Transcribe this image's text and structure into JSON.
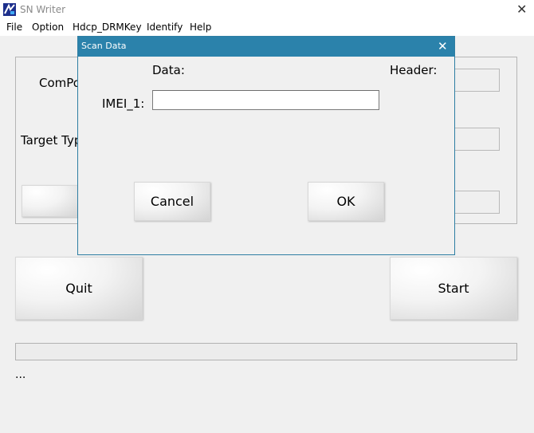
{
  "window": {
    "title": "SN Writer",
    "close_glyph": "✕"
  },
  "menu": [
    "File",
    "Option",
    "Hdcp_DRMKey",
    "Identify",
    "Help"
  ],
  "background": {
    "com_port_label": "ComPo",
    "target_type_label": "Target Typ",
    "quit_label": "Quit",
    "start_label": "Start",
    "status_text": "..."
  },
  "dialog": {
    "title": "Scan Data",
    "close_glyph": "✕",
    "data_label": "Data:",
    "header_label": "Header:",
    "imei_label": "IMEI_1:",
    "imei_value": "",
    "cancel_label": "Cancel",
    "ok_label": "OK"
  },
  "colors": {
    "dialog_title_bar": "#2b82ab",
    "background": "#f0f0f0"
  }
}
